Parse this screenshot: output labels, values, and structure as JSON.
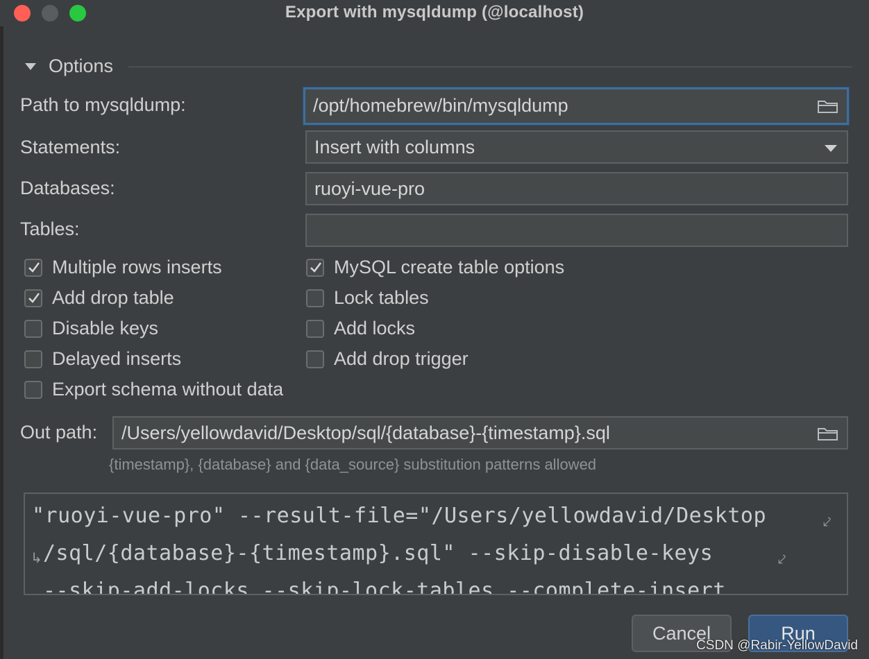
{
  "window": {
    "title": "Export with mysqldump (@localhost)"
  },
  "options": {
    "section_label": "Options",
    "path_label": "Path to mysqldump:",
    "path_value": "/opt/homebrew/bin/mysqldump",
    "statements_label": "Statements:",
    "statements_value": "Insert with columns",
    "databases_label": "Databases:",
    "databases_value": "ruoyi-vue-pro",
    "tables_label": "Tables:",
    "tables_value": ""
  },
  "checkboxes": {
    "multiple_rows_inserts": {
      "label": "Multiple rows inserts",
      "checked": true
    },
    "add_drop_table": {
      "label": "Add drop table",
      "checked": true
    },
    "disable_keys": {
      "label": "Disable keys",
      "checked": false
    },
    "delayed_inserts": {
      "label": "Delayed inserts",
      "checked": false
    },
    "export_schema_without_data": {
      "label": "Export schema without data",
      "checked": false
    },
    "mysql_create_table_options": {
      "label": "MySQL create table options",
      "checked": true
    },
    "lock_tables": {
      "label": "Lock tables",
      "checked": false
    },
    "add_locks": {
      "label": "Add locks",
      "checked": false
    },
    "add_drop_trigger": {
      "label": "Add drop trigger",
      "checked": false
    }
  },
  "out_path": {
    "label": "Out path:",
    "value": "/Users/yellowdavid/Desktop/sql/{database}-{timestamp}.sql",
    "hint": "{timestamp}, {database} and {data_source} substitution patterns allowed"
  },
  "command": {
    "line1": "\"ruoyi-vue-pro\" --result-file=\"/Users/yellowdavid/Desktop",
    "line2": "/sql/{database}-{timestamp}.sql\" --skip-disable-keys",
    "line3": "--skip-add-locks --skip-lock-tables --complete-insert"
  },
  "buttons": {
    "cancel": "Cancel",
    "run": "Run"
  },
  "watermark": "CSDN @Rabir-YellowDavid",
  "icons": {
    "folder": "folder-icon",
    "checkmark": "checkmark-icon",
    "dropdown": "chevron-down-icon",
    "wrap": "soft-wrap-icon"
  }
}
